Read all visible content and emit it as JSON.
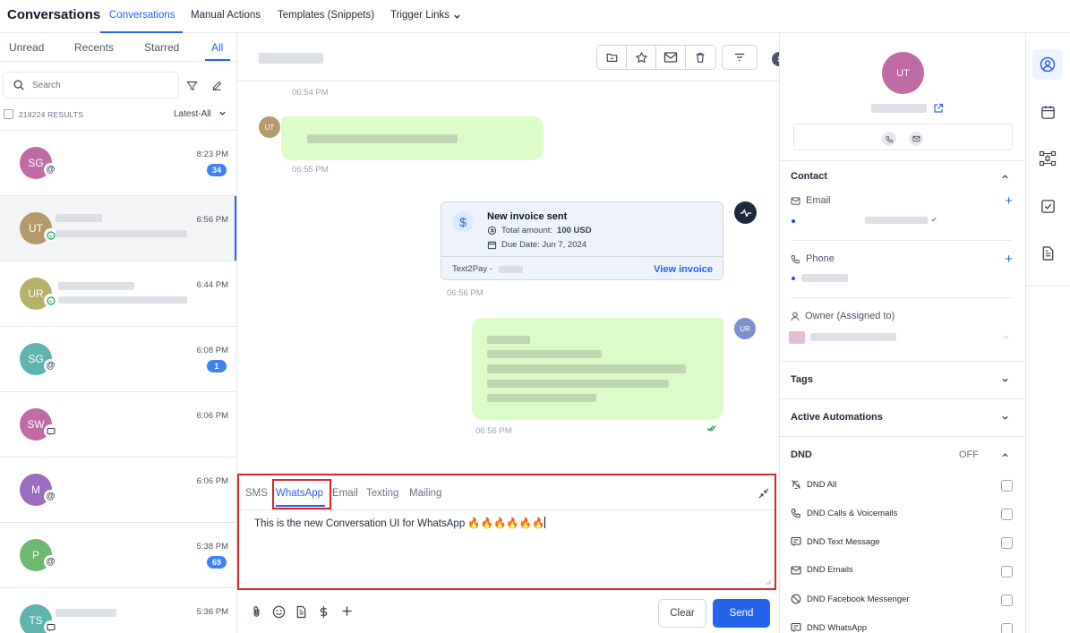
{
  "app": {
    "title": "Conversations"
  },
  "nav": {
    "tabs": [
      {
        "label": "Conversations"
      },
      {
        "label": "Manual Actions"
      },
      {
        "label": "Templates (Snippets)"
      },
      {
        "label": "Trigger Links"
      }
    ]
  },
  "filters": {
    "tabs": [
      {
        "label": "Unread"
      },
      {
        "label": "Recents"
      },
      {
        "label": "Starred"
      },
      {
        "label": "All"
      }
    ]
  },
  "search": {
    "placeholder": "Search"
  },
  "results": {
    "count_label": "218224 RESULTS",
    "sort_label": "Latest-All"
  },
  "conversations": [
    {
      "initials": "SG",
      "time": "8:23 PM",
      "unread": "34",
      "avatar_color": "#c06aa6",
      "channel_icon": "at-icon"
    },
    {
      "initials": "UT",
      "time": "6:56 PM",
      "unread": "",
      "avatar_color": "#b49a6a",
      "channel_icon": "whatsapp-icon"
    },
    {
      "initials": "UR",
      "time": "6:44 PM",
      "unread": "",
      "avatar_color": "#b5b16a",
      "channel_icon": "whatsapp-icon"
    },
    {
      "initials": "SG",
      "time": "6:08 PM",
      "unread": "1",
      "avatar_color": "#5fb3ad",
      "channel_icon": "at-icon"
    },
    {
      "initials": "SW",
      "time": "6:06 PM",
      "unread": "",
      "avatar_color": "#c06aa6",
      "channel_icon": "message-icon"
    },
    {
      "initials": "M",
      "time": "6:06 PM",
      "unread": "",
      "avatar_color": "#9b6cc0",
      "channel_icon": "at-icon"
    },
    {
      "initials": "P",
      "time": "5:38 PM",
      "unread": "69",
      "avatar_color": "#6cb86f",
      "channel_icon": "at-icon"
    },
    {
      "initials": "TS",
      "time": "5:36 PM",
      "unread": "",
      "avatar_color": "#5fb3ad",
      "channel_icon": "message-icon"
    }
  ],
  "thread": {
    "times": [
      "06:54 PM",
      "06:55 PM",
      "06:56 PM",
      "06:56 PM"
    ],
    "incoming_avatar": "UT",
    "outgoing_avatar": "UR",
    "invoice": {
      "title": "New invoice sent",
      "amount_label": "Total amount:",
      "amount_value": "100 USD",
      "due_label": "Due Date: Jun 7, 2024",
      "source": "Text2Pay -",
      "link": "View invoice"
    }
  },
  "composer": {
    "tabs": [
      {
        "label": "SMS"
      },
      {
        "label": "WhatsApp"
      },
      {
        "label": "Email"
      },
      {
        "label": "Texting"
      },
      {
        "label": "Mailing"
      }
    ],
    "text": "This is the new Conversation UI for WhatsApp 🔥🔥🔥🔥🔥🔥",
    "clear_label": "Clear",
    "send_label": "Send"
  },
  "contact": {
    "initials": "UT",
    "section_title": "Contact",
    "email_label": "Email",
    "phone_label": "Phone",
    "owner_label": "Owner (Assigned to)",
    "tags_label": "Tags",
    "automations_label": "Active Automations",
    "dnd_label": "DND",
    "dnd_status": "OFF",
    "dnd_items": [
      {
        "label": "DND All",
        "icon": "bell-off-icon"
      },
      {
        "label": "DND Calls & Voicemails",
        "icon": "phone-icon"
      },
      {
        "label": "DND Text Message",
        "icon": "message-icon"
      },
      {
        "label": "DND Emails",
        "icon": "mail-icon"
      },
      {
        "label": "DND Facebook Messenger",
        "icon": "ban-icon"
      },
      {
        "label": "DND WhatsApp",
        "icon": "message-icon"
      }
    ]
  },
  "colors": {
    "accent": "#2563eb",
    "bubble": "#dcfcc7",
    "highlight": "#dc2626"
  }
}
